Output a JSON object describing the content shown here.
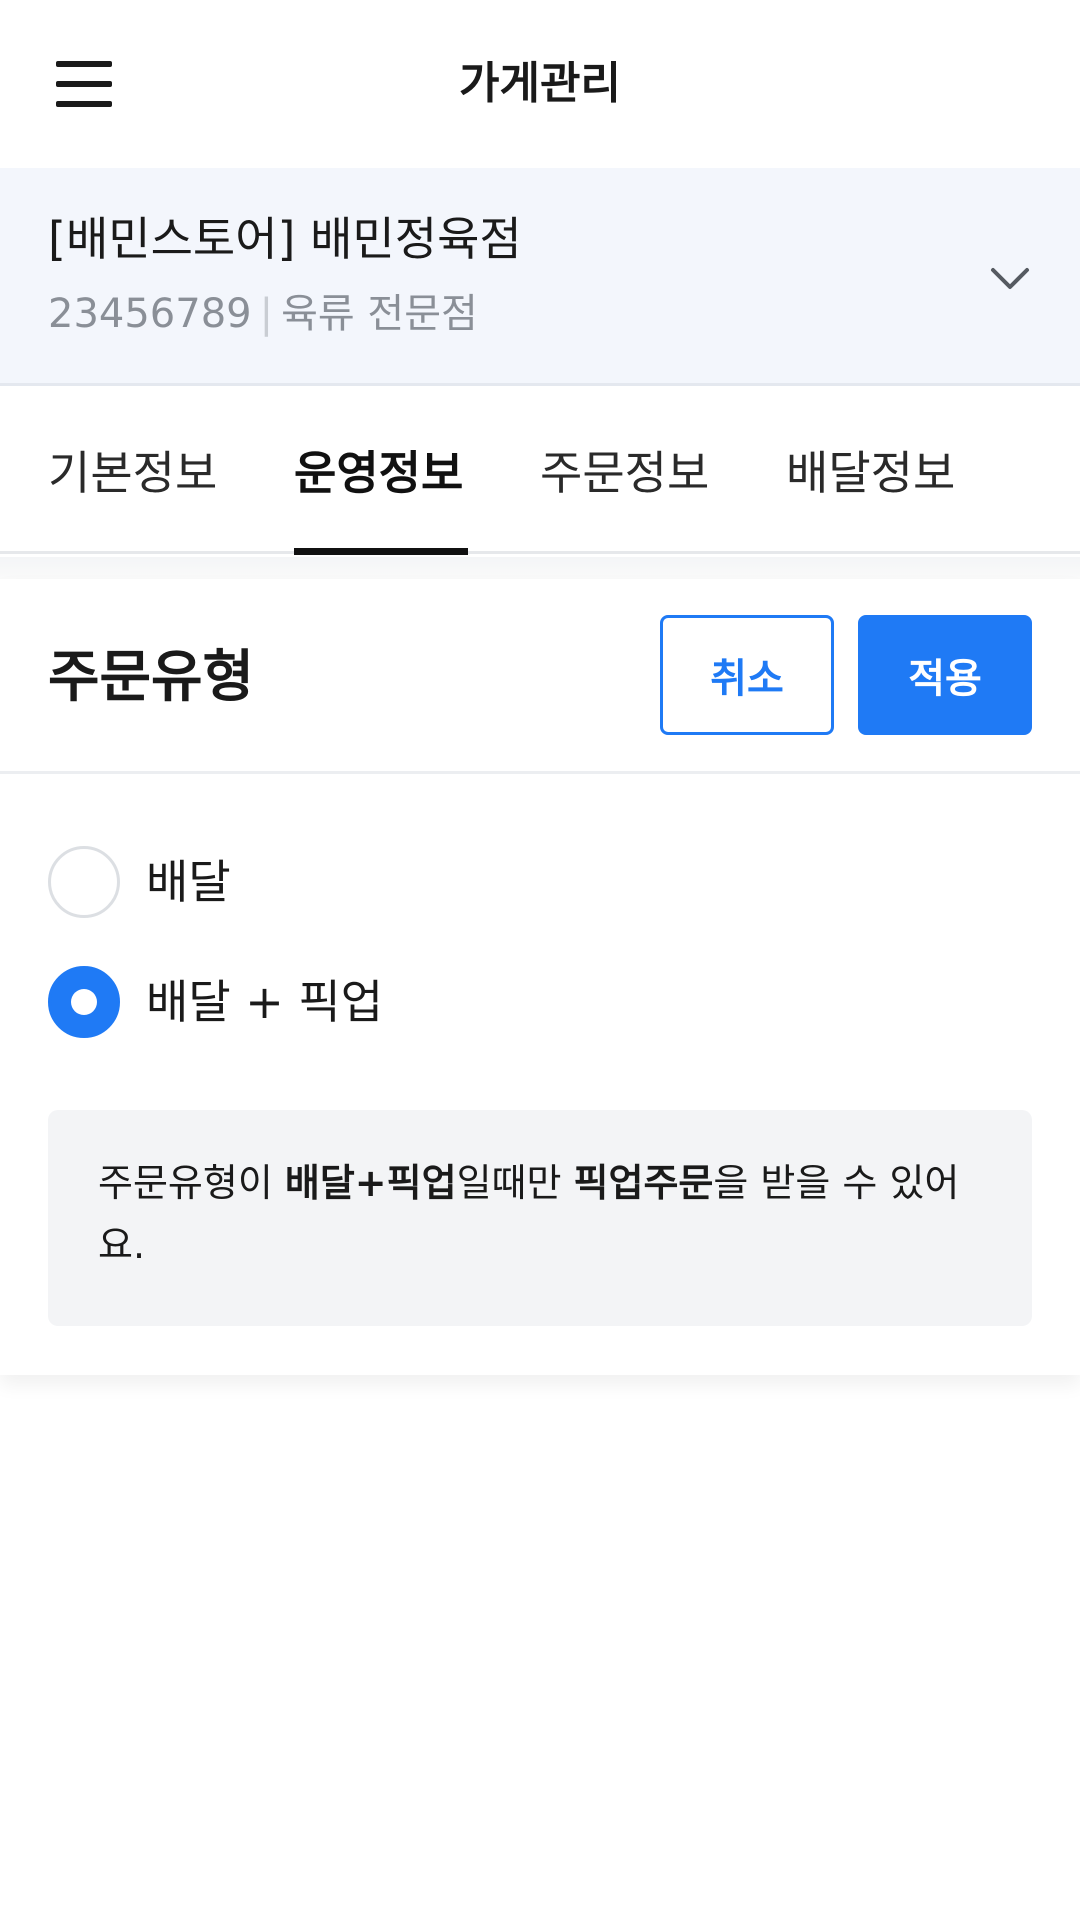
{
  "header": {
    "title": "가게관리",
    "menu_icon": "hamburger-menu-icon"
  },
  "store": {
    "name": "[배민스토어] 배민정육점",
    "id": "23456789",
    "separator": "|",
    "category": "육류 전문점",
    "dropdown_icon": "chevron-down-icon"
  },
  "tabs": [
    {
      "label": "기본정보",
      "active": false
    },
    {
      "label": "운영정보",
      "active": true
    },
    {
      "label": "주문정보",
      "active": false
    },
    {
      "label": "배달정보",
      "active": false
    }
  ],
  "section": {
    "title": "주문유형",
    "cancel_label": "취소",
    "apply_label": "적용"
  },
  "options": [
    {
      "label": "배달",
      "selected": false
    },
    {
      "label": "배달 + 픽업",
      "selected": true
    }
  ],
  "notice": {
    "part1": "주문유형이 ",
    "bold1": "배달+픽업",
    "part2": "일때만 ",
    "bold2": "픽업주문",
    "part3": "을 받을 수 있어요."
  },
  "colors": {
    "accent": "#1f7af5",
    "store_bg": "#f3f6fc",
    "notice_bg": "#f3f4f6"
  }
}
